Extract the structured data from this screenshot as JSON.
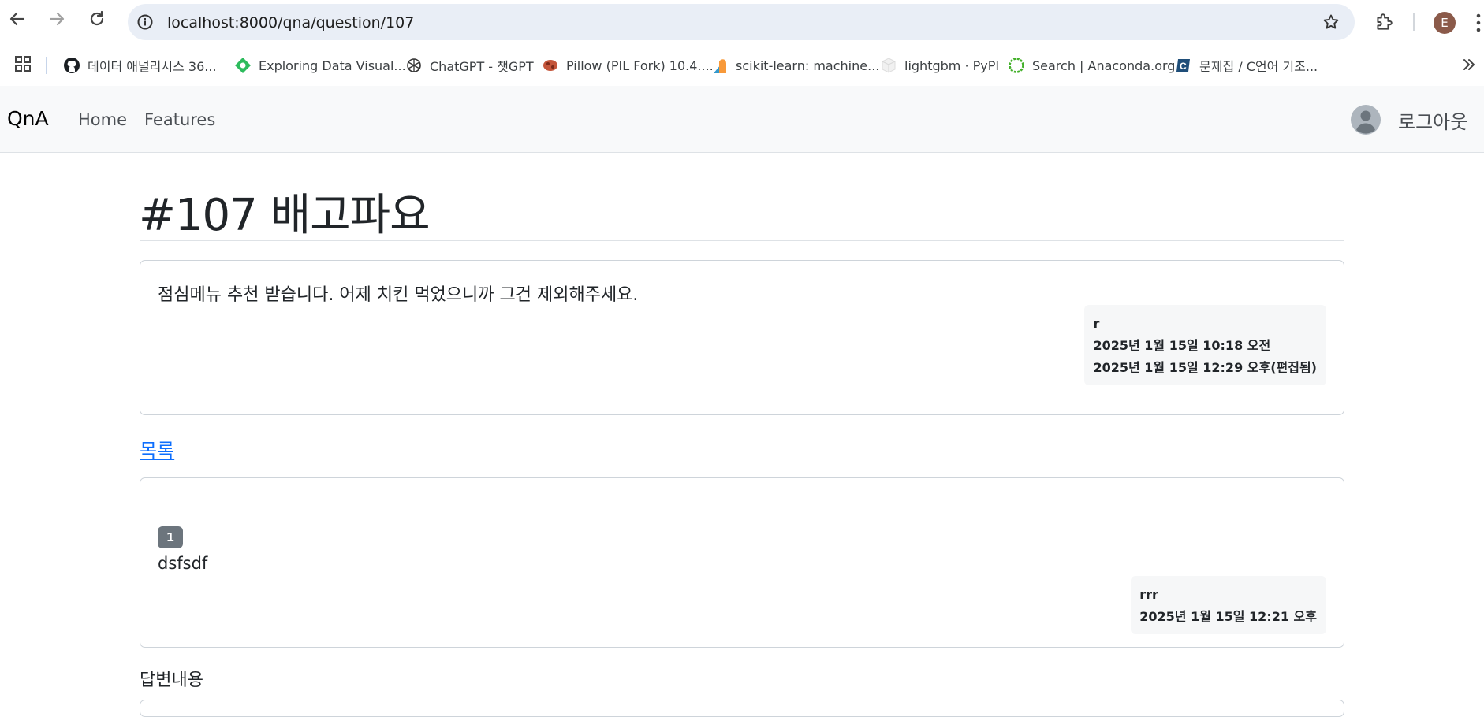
{
  "browser": {
    "url": "localhost:8000/qna/question/107",
    "profile_initial": "E",
    "bookmarks": [
      {
        "label": "데이터 애널리시스 36...",
        "icon": "github-icon"
      },
      {
        "label": "Exploring Data Visual...",
        "icon": "diamond-icon"
      },
      {
        "label": "ChatGPT - 챗GPT",
        "icon": "openai-icon"
      },
      {
        "label": "Pillow (PIL Fork) 10.4....",
        "icon": "pillow-icon"
      },
      {
        "label": "scikit-learn: machine...",
        "icon": "sklearn-icon"
      },
      {
        "label": "lightgbm · PyPI",
        "icon": "pypi-icon"
      },
      {
        "label": "Search | Anaconda.org",
        "icon": "anaconda-icon"
      },
      {
        "label": "문제집 / C언어 기조...",
        "icon": "codeup-icon"
      }
    ]
  },
  "navbar": {
    "brand": "QnA",
    "links": [
      "Home",
      "Features"
    ],
    "logout": "로그아웃"
  },
  "question": {
    "title": "#107 배고파요",
    "content": "점심메뉴 추천 받습니다. 어제 치킨 먹었으니까 그건 제외해주세요.",
    "author": "r",
    "created": "2025년 1월 15일 10:18 오전",
    "modified": "2025년 1월 15일 12:29 오후(편집됨)"
  },
  "list_link": "목록",
  "answers": [
    {
      "badge": "1",
      "content": "dsfsdf",
      "author": "rrr",
      "created": "2025년 1월 15일 12:21 오후"
    }
  ],
  "answer_form": {
    "label": "답변내용"
  },
  "colors": {
    "link": "#0d6efd",
    "navbar_bg": "#f8f9fa",
    "badge_bg": "#6c757d"
  }
}
